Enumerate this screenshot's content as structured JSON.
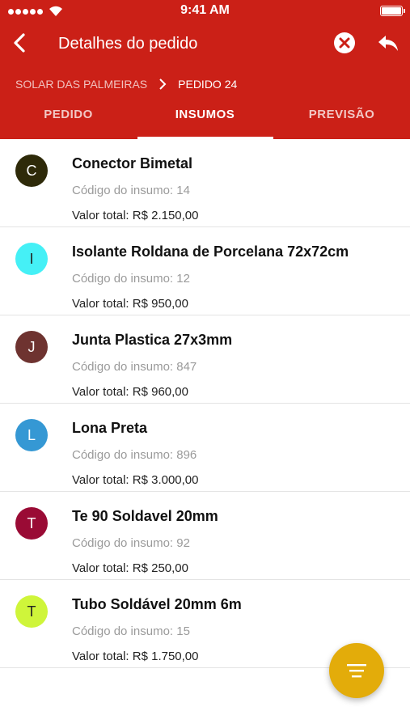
{
  "status_bar": {
    "time": "9:41 AM",
    "icons": [
      "signal-dots-icon",
      "wifi-icon",
      "battery-icon"
    ]
  },
  "app_bar": {
    "title": "Detalhes do pedido",
    "back_icon": "arrow-left-icon",
    "close_icon": "close-circle-icon",
    "reply_icon": "reply-icon"
  },
  "breadcrumb": {
    "items": [
      "SOLAR DAS PALMEIRAS",
      "PEDIDO 24"
    ],
    "separator_icon": "chevron-right-icon"
  },
  "tabs": [
    {
      "label": "PEDIDO",
      "active": false
    },
    {
      "label": "INSUMOS",
      "active": true
    },
    {
      "label": "PREVISÃO",
      "active": false
    }
  ],
  "colors": {
    "header": "#cb2017",
    "fab": "#e3ac0a"
  },
  "items": [
    {
      "initial": "C",
      "avatar_color": "#2e2a09",
      "name": "Conector Bimetal",
      "code_label": "Código do insumo: 14",
      "total_label": "Valor total:",
      "total_value": "R$ 2.150,00"
    },
    {
      "initial": "I",
      "avatar_color": "#45f0f6",
      "name": "Isolante Roldana de Porcelana 72x72cm",
      "code_label": "Código do insumo: 12",
      "total_label": "Valor total:",
      "total_value": "R$ 950,00"
    },
    {
      "initial": "J",
      "avatar_color": "#6e3330",
      "name": "Junta Plastica 27x3mm",
      "code_label": "Código do insumo: 847",
      "total_label": "Valor total:",
      "total_value": "R$ 960,00"
    },
    {
      "initial": "L",
      "avatar_color": "#3598d4",
      "name": "Lona Preta",
      "code_label": "Código do insumo: 896",
      "total_label": "Valor total:",
      "total_value": "R$ 3.000,00"
    },
    {
      "initial": "T",
      "avatar_color": "#9a0b35",
      "name": "Te 90 Soldavel 20mm",
      "code_label": "Código do insumo: 92",
      "total_label": "Valor total:",
      "total_value": "R$ 250,00"
    },
    {
      "initial": "T",
      "avatar_color": "#cff53a",
      "name": "Tubo Soldável 20mm 6m",
      "code_label": "Código do insumo: 15",
      "total_label": "Valor total:",
      "total_value": "R$ 1.750,00"
    }
  ],
  "fab": {
    "icon": "filter-list-icon"
  }
}
